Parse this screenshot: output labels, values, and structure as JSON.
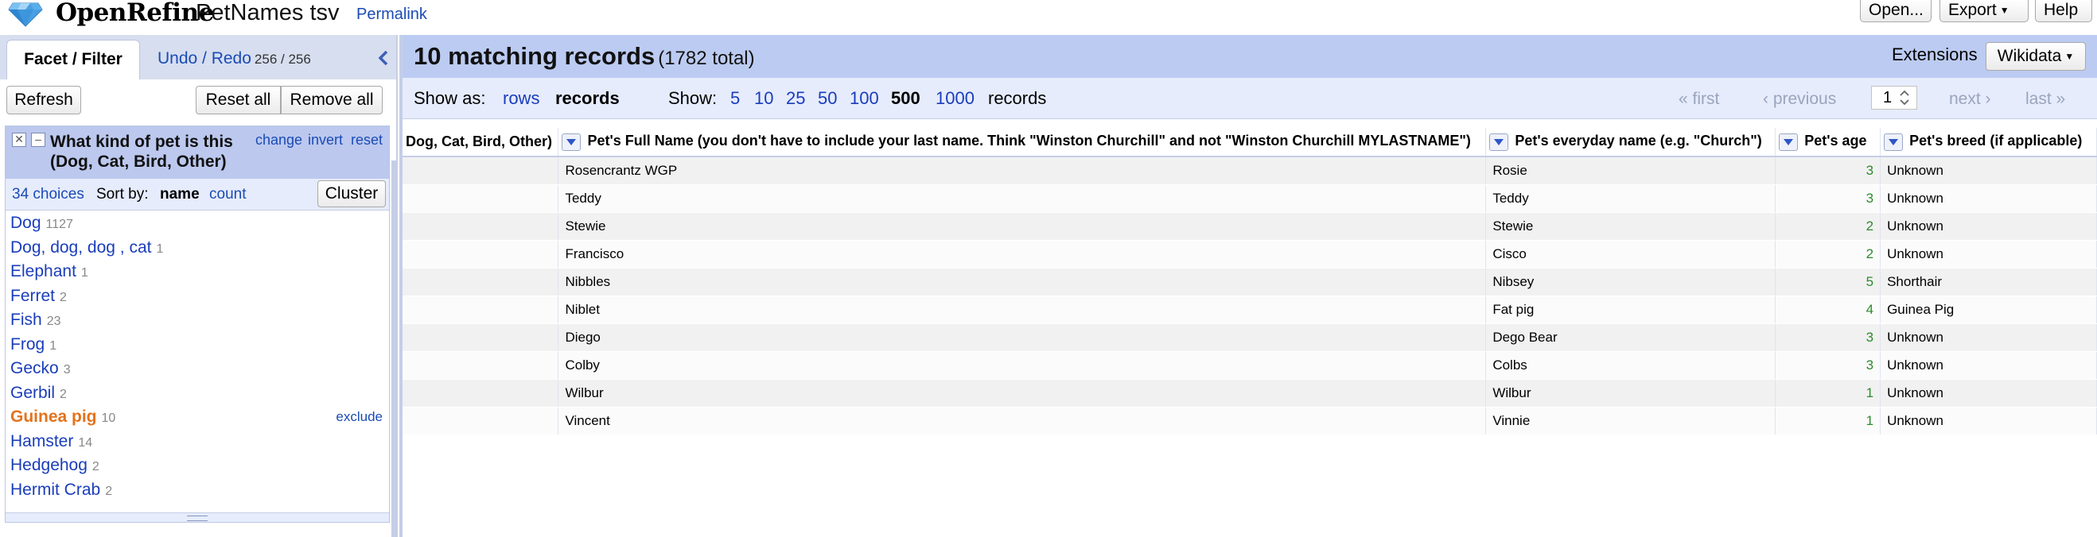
{
  "header": {
    "app_name": "OpenRefine",
    "project_name": "PetNames tsv",
    "permalink": "Permalink",
    "open_label": "Open...",
    "export_label": "Export",
    "help_label": "Help",
    "logo_icon": "diamond-logo-icon"
  },
  "left_panel": {
    "tabs": {
      "facet_filter": "Facet / Filter",
      "undo_redo": "Undo / Redo",
      "undo_count": "256 / 256"
    },
    "buttons": {
      "refresh": "Refresh",
      "reset_all": "Reset all",
      "remove_all": "Remove all"
    },
    "facet": {
      "title": "What kind of pet is this (Dog, Cat, Bird, Other)",
      "change": "change",
      "invert": "invert",
      "reset": "reset",
      "choices_count": "34 choices",
      "sort_by": "Sort by:",
      "sort_name": "name",
      "sort_count": "count",
      "cluster": "Cluster",
      "exclude": "exclude",
      "choices": [
        {
          "label": "Dog",
          "count": "1127"
        },
        {
          "label": "Dog, dog, dog , cat",
          "count": "1"
        },
        {
          "label": "Elephant",
          "count": "1"
        },
        {
          "label": "Ferret",
          "count": "2"
        },
        {
          "label": "Fish",
          "count": "23"
        },
        {
          "label": "Frog",
          "count": "1"
        },
        {
          "label": "Gecko",
          "count": "3"
        },
        {
          "label": "Gerbil",
          "count": "2"
        },
        {
          "label": "Guinea pig",
          "count": "10",
          "selected": true
        },
        {
          "label": "Hamster",
          "count": "14"
        },
        {
          "label": "Hedgehog",
          "count": "2"
        },
        {
          "label": "Hermit Crab",
          "count": "2"
        }
      ]
    }
  },
  "right_panel": {
    "summary": {
      "matching": "10 matching records",
      "total": "(1782 total)"
    },
    "extensions_label": "Extensions",
    "wikidata_label": "Wikidata",
    "view_bar": {
      "show_as": "Show as:",
      "rows": "rows",
      "records": "records",
      "show": "Show:",
      "page_sizes": [
        "5",
        "10",
        "25",
        "50",
        "100",
        "500",
        "1000"
      ],
      "active_page_size": "500",
      "records_suffix": "records",
      "first": "« first",
      "previous": "‹ previous",
      "page_value": "1",
      "next": "next ›",
      "last": "last »"
    },
    "table": {
      "columns": [
        "Dog, Cat, Bird, Other)",
        "Pet's Full Name (you don't have to include your last name. Think \"Winston Churchill\" and not \"Winston Churchill MYLASTNAME\")",
        "Pet's everyday name (e.g. \"Church\")",
        "Pet's age",
        "Pet's breed (if applicable)"
      ],
      "rows": [
        [
          "",
          "Rosencrantz WGP",
          "Rosie",
          "3",
          "Unknown"
        ],
        [
          "",
          "Teddy",
          "Teddy",
          "3",
          "Unknown"
        ],
        [
          "",
          "Stewie",
          "Stewie",
          "2",
          "Unknown"
        ],
        [
          "",
          "Francisco",
          "Cisco",
          "2",
          "Unknown"
        ],
        [
          "",
          "Nibbles",
          "Nibsey",
          "5",
          "Shorthair"
        ],
        [
          "",
          "Niblet",
          "Fat pig",
          "4",
          "Guinea Pig"
        ],
        [
          "",
          "Diego",
          "Dego Bear",
          "3",
          "Unknown"
        ],
        [
          "",
          "Colby",
          "Colbs",
          "3",
          "Unknown"
        ],
        [
          "",
          "Wilbur",
          "Wilbur",
          "1",
          "Unknown"
        ],
        [
          "",
          "Vincent",
          "Vinnie",
          "1",
          "Unknown"
        ]
      ]
    }
  }
}
